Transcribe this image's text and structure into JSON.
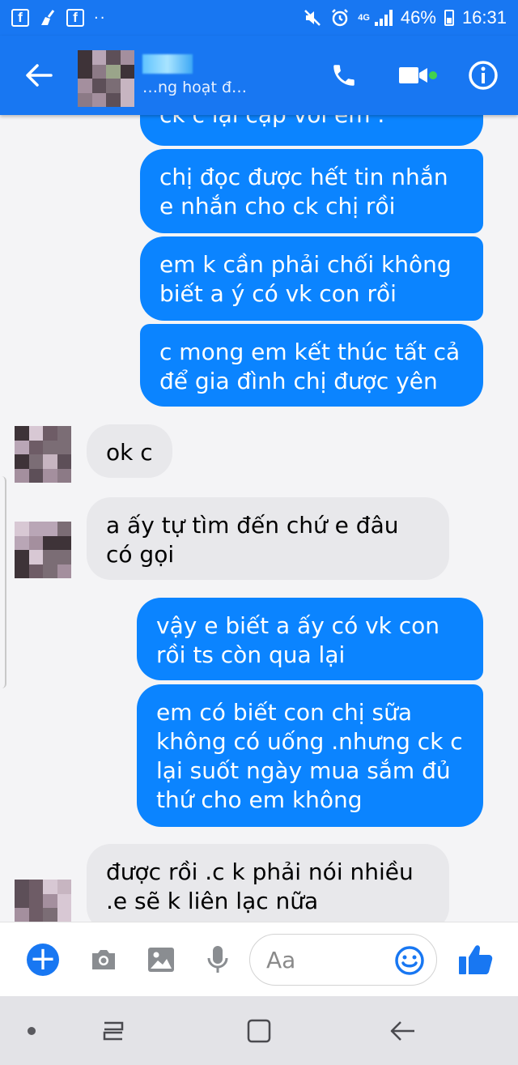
{
  "status_bar": {
    "left_icons": [
      "facebook-icon",
      "cleaner-icon",
      "facebook-icon",
      "more-dots-icon"
    ],
    "network_label": "4G",
    "battery": "46%",
    "time": "16:31"
  },
  "header": {
    "status": "…ng hoạt đ…",
    "back_icon": "arrow-left-icon",
    "actions": [
      "phone-icon",
      "video-icon",
      "info-icon"
    ],
    "active_color": "#42d24d"
  },
  "messages": [
    {
      "side": "out",
      "text": "ck c lại cặp với em ."
    },
    {
      "side": "out",
      "text": "chị đọc được hết tin nhắn e nhắn cho ck chị rồi"
    },
    {
      "side": "out",
      "text": "em k cần phải chối không biết a ý có vk con rồi"
    },
    {
      "side": "out",
      "text": "c mong em kết thúc tất cả để gia đình chị được yên"
    },
    {
      "side": "in",
      "text": "ok c"
    },
    {
      "side": "in",
      "text": "a ấy tự tìm đến chứ e đâu có gọi"
    },
    {
      "side": "out",
      "text": "vậy e biết a ấy có vk con rồi ts còn qua lại"
    },
    {
      "side": "out",
      "text": "em có biết con chị sữa không có uống .nhưng ck c lại suốt ngày mua sắm đủ thứ cho em không"
    },
    {
      "side": "in",
      "text": "được rồi .c k phải nói nhiều .e sẽ k liên lạc nữa"
    }
  ],
  "composer": {
    "placeholder": "Aa",
    "icons": [
      "plus-icon",
      "camera-icon",
      "image-icon",
      "microphone-icon",
      "emoji-icon",
      "thumbs-up-icon"
    ]
  },
  "navbar": {
    "icons": [
      "dot-icon",
      "recents-icon",
      "home-icon",
      "back-icon"
    ]
  },
  "colors": {
    "accent": "#1877f2",
    "outgoing_bubble": "#0b84ff",
    "incoming_bubble": "#e8e8eb"
  }
}
